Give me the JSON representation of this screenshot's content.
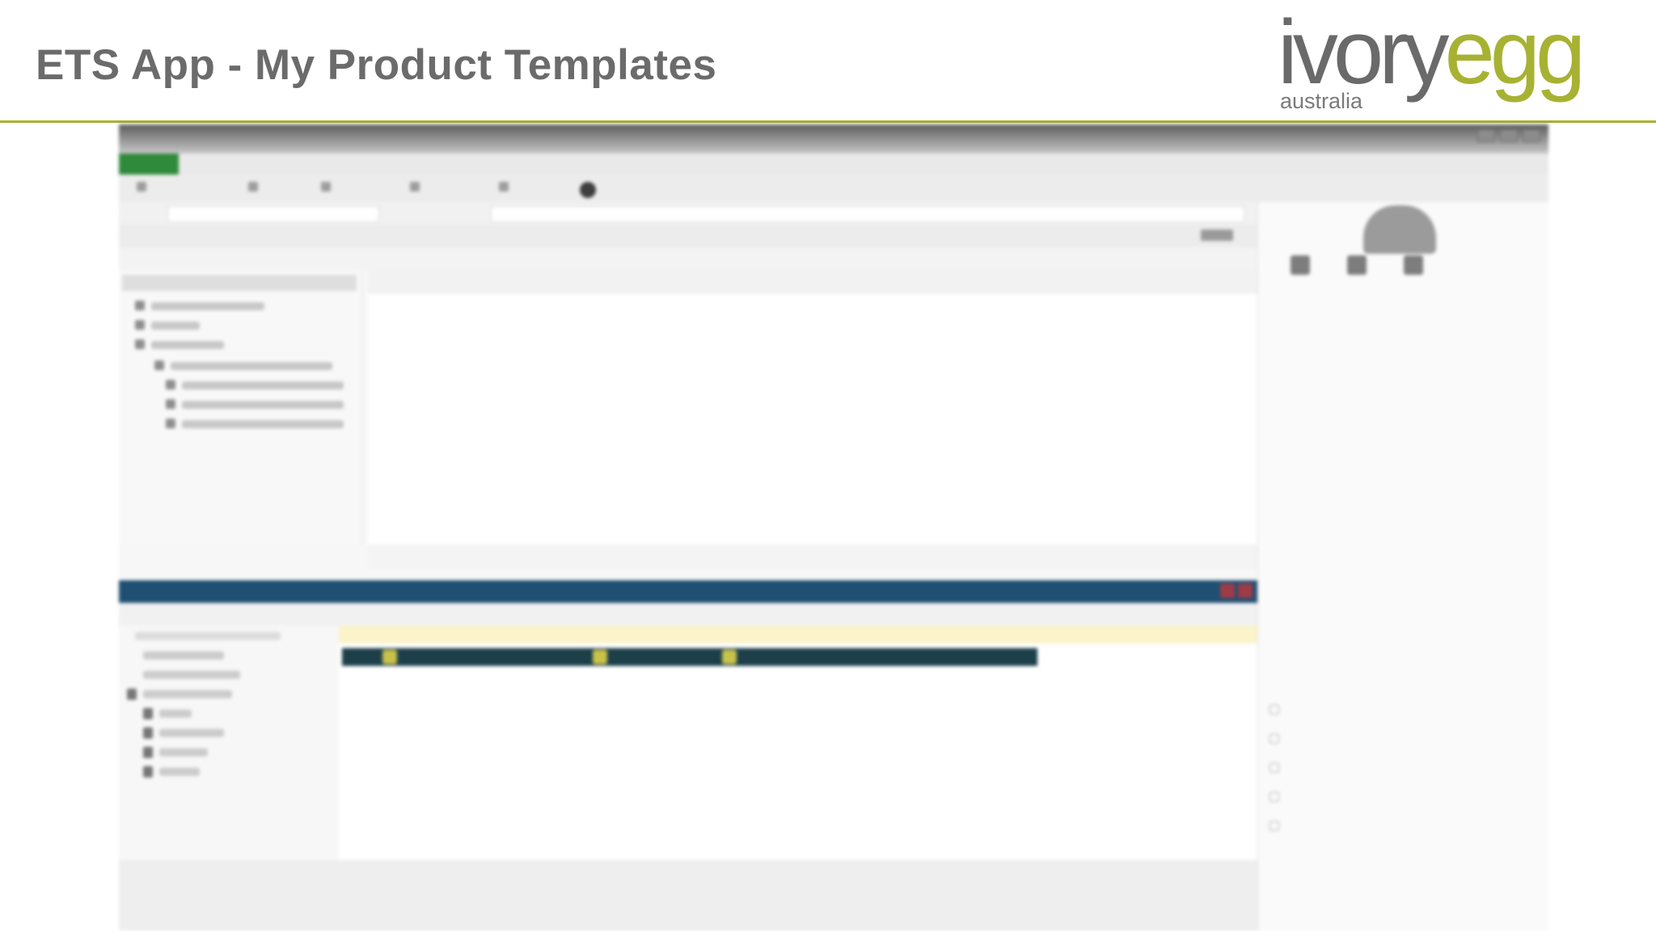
{
  "slide": {
    "title": "ETS App - My Product Templates"
  },
  "logo": {
    "brand_part1": "ivory",
    "brand_part2": "egg",
    "sub": "australia",
    "colors": {
      "grey": "#6a6a6a",
      "green": "#a7b233"
    }
  },
  "divider_color": "#a7b233",
  "screenshot": {
    "blurred": true,
    "app_title": "",
    "ribbon": {
      "file_tab": "",
      "tabs": [
        "",
        "",
        "",
        "",
        ""
      ]
    },
    "panel_title": "",
    "accent_colors": {
      "file_tab": "#2f8a3b",
      "title_bar": "#1f4f73",
      "highlight_band": "#fbf3c9",
      "selected_row": "#1d3f4a"
    }
  }
}
